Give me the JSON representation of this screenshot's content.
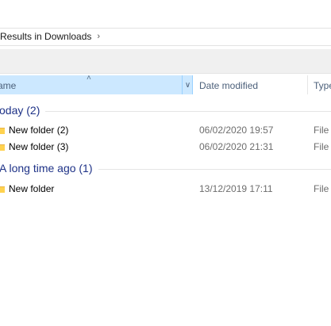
{
  "breadcrumb": {
    "location": "Results in Downloads",
    "chevron": "chevron-right-icon"
  },
  "columns": {
    "name": "ame",
    "date_modified": "Date modified",
    "type": "Type"
  },
  "groups": [
    {
      "label": "oday (2)",
      "files": [
        {
          "name": "New folder (2)",
          "date": "06/02/2020 19:57",
          "type": "File f"
        },
        {
          "name": "New folder (3)",
          "date": "06/02/2020 21:31",
          "type": "File f"
        }
      ]
    },
    {
      "label": "A long time ago (1)",
      "files": [
        {
          "name": "New folder",
          "date": "13/12/2019 17:11",
          "type": "File f"
        }
      ]
    }
  ],
  "colors": {
    "selected_header": "#cce8ff",
    "group_text": "#1e3287",
    "folder": "#ffd24f"
  }
}
